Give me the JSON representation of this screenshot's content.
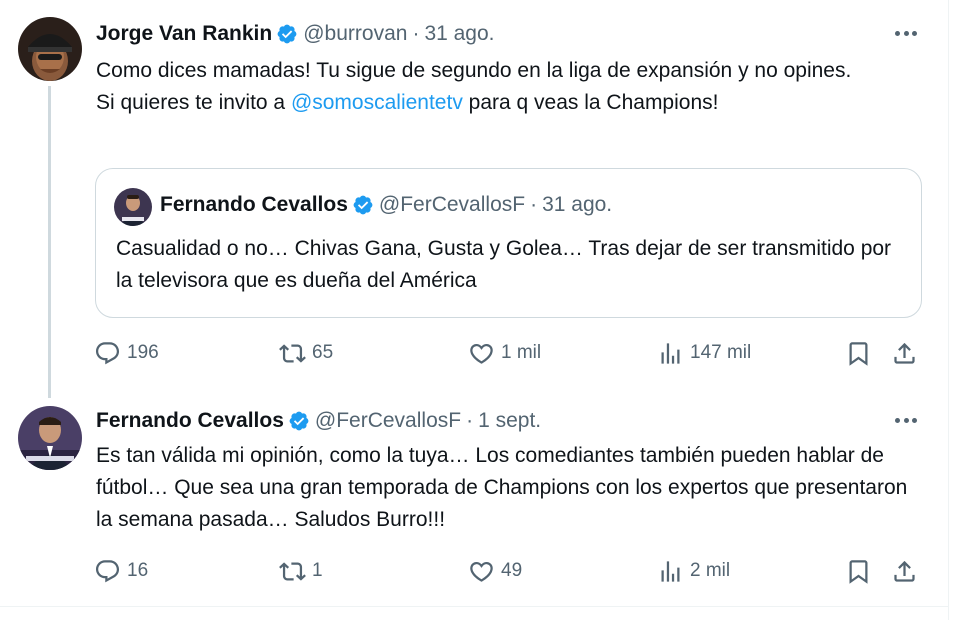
{
  "tweets": [
    {
      "name": "Jorge Van Rankin",
      "handle": "@burrovan",
      "time": "31 ago.",
      "text_parts": [
        "Como dices mamadas! Tu sigue de segundo en la liga de expansión y no opines.",
        "Si quieres te invito a ",
        "@somoscalientetv",
        " para q veas la Champions!"
      ],
      "quote": {
        "name": "Fernando Cevallos",
        "handle": "@FerCevallosF",
        "time": "31 ago.",
        "text": "Casualidad o no… Chivas Gana, Gusta y Golea… Tras dejar de ser transmitido por la televisora que es dueña del América"
      },
      "actions": {
        "replies": "196",
        "retweets": "65",
        "likes": "1 mil",
        "views": "147 mil"
      }
    },
    {
      "name": "Fernando Cevallos",
      "handle": "@FerCevallosF",
      "time": "1 sept.",
      "text": "Es tan válida mi opinión, como la tuya… Los comediantes también pueden hablar de fútbol… Que sea una gran temporada de Champions con los expertos que presentaron la semana pasada… Saludos Burro!!!",
      "actions": {
        "replies": "16",
        "retweets": "1",
        "likes": "49",
        "views": "2 mil"
      }
    }
  ],
  "separator": "·",
  "icons": {
    "verified": "verified-badge-icon",
    "more": "more-horizontal-icon",
    "reply": "reply-icon",
    "retweet": "retweet-icon",
    "like": "heart-icon",
    "views": "views-icon",
    "bookmark": "bookmark-icon",
    "share": "share-icon"
  },
  "colors": {
    "text": "#0f1419",
    "secondary": "#536471",
    "link": "#1d9bf0",
    "verified": "#1d9bf0",
    "border": "#cfd9de"
  }
}
